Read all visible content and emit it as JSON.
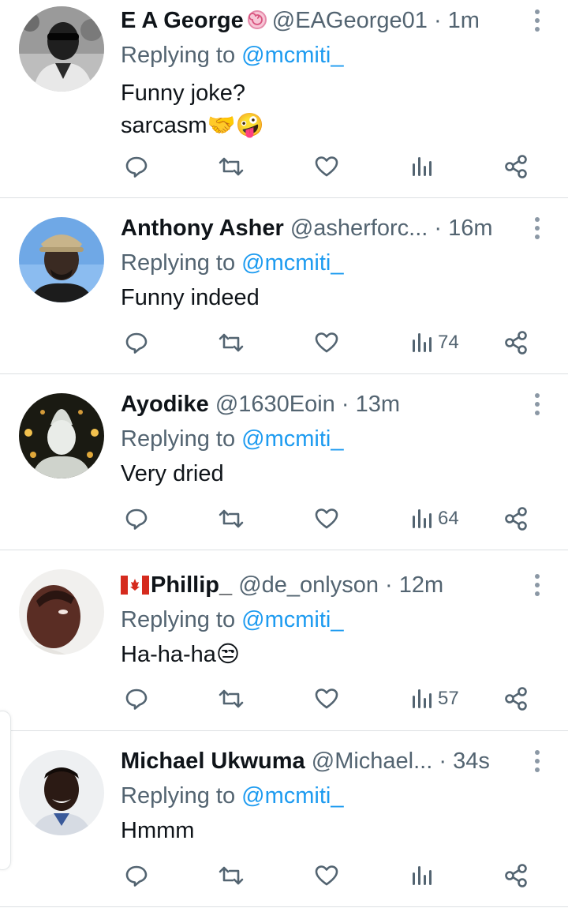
{
  "tweets": [
    {
      "name": "E A George",
      "handle": "@EAGeorge01",
      "time": "· 1m",
      "replying_prefix": "Replying to ",
      "replying_to": "@mcmiti_",
      "lines": [
        "Funny joke?",
        "sarcasm🤝🤪"
      ],
      "views": "",
      "badge_icon": "lollipop-icon"
    },
    {
      "name": "Anthony Asher",
      "handle": "@asherforc...",
      "time": "· 16m",
      "replying_prefix": "Replying to ",
      "replying_to": "@mcmiti_",
      "lines": [
        "Funny indeed"
      ],
      "views": "74"
    },
    {
      "name": "Ayodike",
      "handle": "@1630Eoin",
      "time": "· 13m",
      "replying_prefix": "Replying to ",
      "replying_to": "@mcmiti_",
      "lines": [
        "Very dried"
      ],
      "views": "64"
    },
    {
      "name": "Phillip_",
      "handle": "@de_onlyson",
      "time": "· 12m",
      "replying_prefix": "Replying to ",
      "replying_to": "@mcmiti_",
      "lines": [
        "Ha-ha-ha😒"
      ],
      "views": "57",
      "flag_icon": "canada-flag-icon"
    },
    {
      "name": "Michael Ukwuma",
      "handle": "@Michael...",
      "time": "· 34s",
      "replying_prefix": "Replying to ",
      "replying_to": "@mcmiti_",
      "lines": [
        "Hmmm"
      ],
      "views": ""
    }
  ],
  "colors": {
    "text": "#0f1419",
    "secondary": "#536471",
    "mention": "#1d9bf0",
    "divider": "#dcdfe2"
  }
}
